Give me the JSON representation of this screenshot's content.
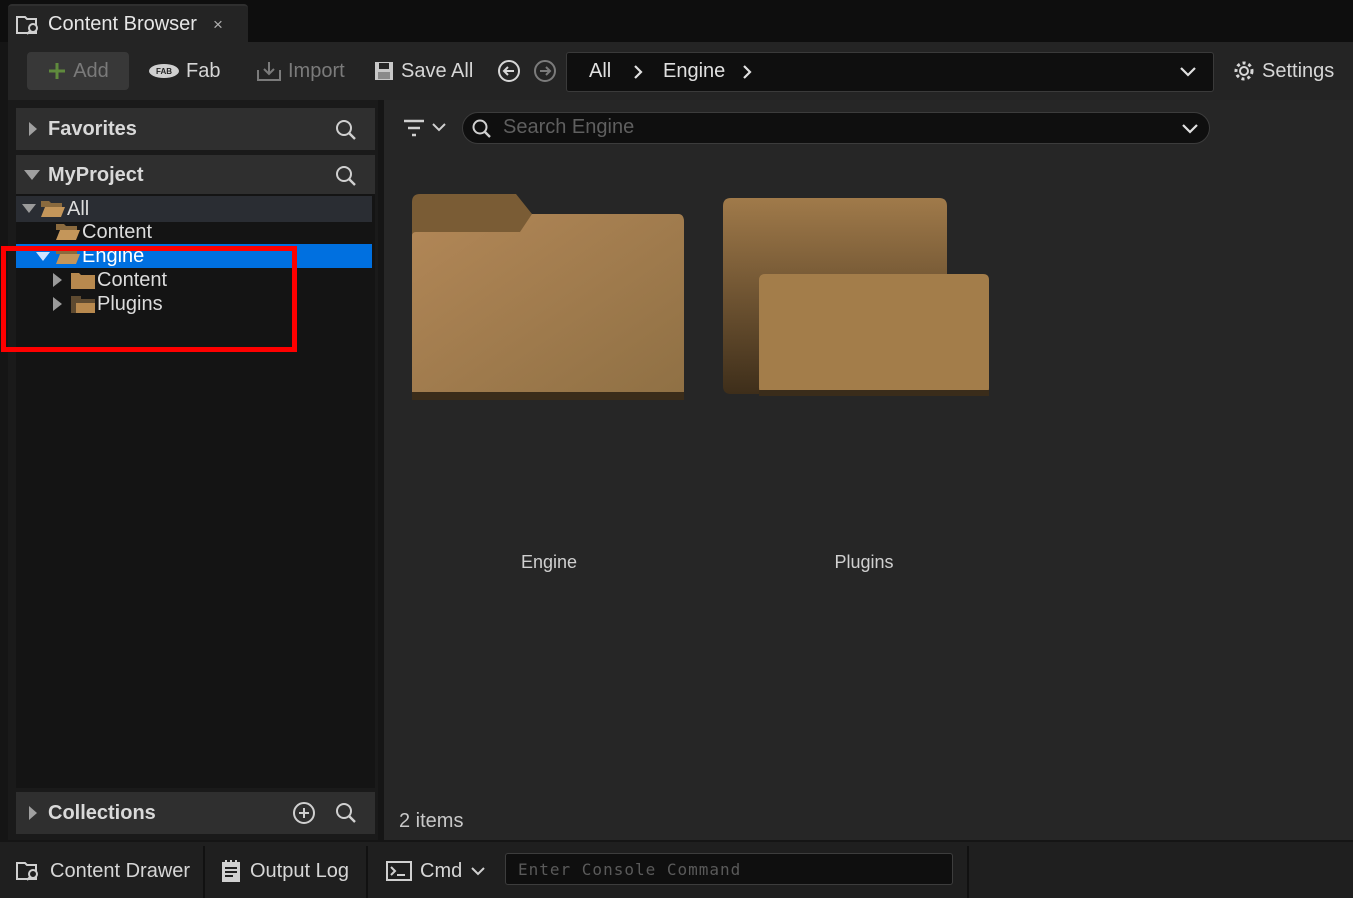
{
  "tab": {
    "title": "Content Browser",
    "close": "×"
  },
  "toolbar": {
    "add": "Add",
    "fab": "Fab",
    "import": "Import",
    "save_all": "Save All",
    "settings": "Settings"
  },
  "breadcrumb": {
    "items": [
      "All",
      "Engine"
    ]
  },
  "sidebar": {
    "favorites": "Favorites",
    "project": "MyProject",
    "collections": "Collections",
    "tree": {
      "all": "All",
      "content": "Content",
      "engine": "Engine",
      "engine_content": "Content",
      "engine_plugins": "Plugins"
    }
  },
  "search": {
    "placeholder": "Search Engine"
  },
  "assets": [
    {
      "label": "Engine"
    },
    {
      "label": "Plugins"
    }
  ],
  "item_count": "2 items",
  "statusbar": {
    "content_drawer": "Content Drawer",
    "output_log": "Output Log",
    "cmd": "Cmd",
    "console_placeholder": "Enter Console Command"
  },
  "colors": {
    "folder": "#a37d4a",
    "selection": "#0070e0",
    "highlight_box": "#ff0000"
  }
}
